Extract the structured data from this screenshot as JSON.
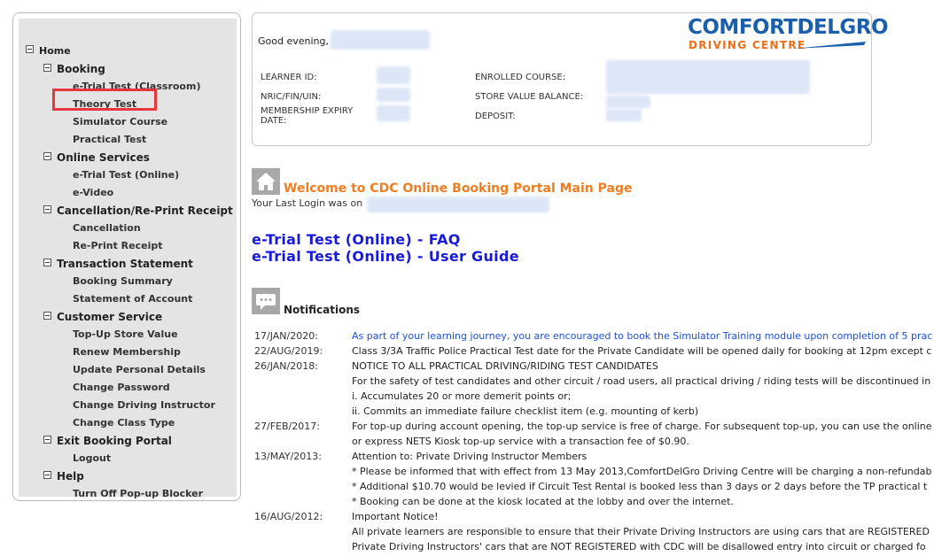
{
  "sidebar": {
    "items": [
      {
        "label": "Home",
        "level": 0,
        "toggle": true
      },
      {
        "label": "Booking",
        "level": 1,
        "toggle": true
      },
      {
        "label": "e-Trial Test (Classroom)",
        "level": 2
      },
      {
        "label": "Theory Test",
        "level": 2,
        "highlighted": true
      },
      {
        "label": "Simulator Course",
        "level": 2
      },
      {
        "label": "Practical Test",
        "level": 2
      },
      {
        "label": "Online Services",
        "level": 1,
        "toggle": true
      },
      {
        "label": "e-Trial Test (Online)",
        "level": 2
      },
      {
        "label": "e-Video",
        "level": 2
      },
      {
        "label": "Cancellation/Re-Print Receipt",
        "level": 1,
        "toggle": true
      },
      {
        "label": "Cancellation",
        "level": 2
      },
      {
        "label": "Re-Print Receipt",
        "level": 2
      },
      {
        "label": "Transaction Statement",
        "level": 1,
        "toggle": true
      },
      {
        "label": "Booking Summary",
        "level": 2
      },
      {
        "label": "Statement of Account",
        "level": 2
      },
      {
        "label": "Customer Service",
        "level": 1,
        "toggle": true
      },
      {
        "label": "Top-Up Store Value",
        "level": 2
      },
      {
        "label": "Renew Membership",
        "level": 2
      },
      {
        "label": "Update Personal Details",
        "level": 2
      },
      {
        "label": "Change Password",
        "level": 2
      },
      {
        "label": "Change Driving Instructor",
        "level": 2
      },
      {
        "label": "Change Class Type",
        "level": 2
      },
      {
        "label": "Exit Booking Portal",
        "level": 1,
        "toggle": true
      },
      {
        "label": "Logout",
        "level": 2
      },
      {
        "label": "Help",
        "level": 1,
        "toggle": true
      },
      {
        "label": "Turn Off Pop-up Blocker",
        "level": 2
      }
    ],
    "highlight_color": "#e8373c"
  },
  "card": {
    "greeting": "Good evening,",
    "labels": {
      "learner_id": "LEARNER ID:",
      "nric": "NRIC/FIN/UIN:",
      "membership_expiry": "MEMBERSHIP EXPIRY DATE:",
      "enrolled_course": "ENROLLED COURSE:",
      "store_value_balance": "STORE VALUE BALANCE:",
      "deposit": "DEPOSIT:"
    },
    "logo": {
      "top": "COMFORTDELGRO",
      "bottom": "DRIVING CENTRE",
      "top_color": "#1b5faa",
      "bottom_color": "#ef6d19"
    }
  },
  "main": {
    "welcome": "Welcome to CDC Online Booking Portal Main Page",
    "last_login": "Your Last Login was on",
    "links": {
      "faq": "e-Trial Test (Online) - FAQ",
      "guide": "e-Trial Test (Online) - User Guide"
    },
    "notifications_title": "Notifications",
    "notifications": [
      {
        "date": "17/JAN/2020:",
        "text": "As part of your learning journey, you are encouraged to book the Simulator Training module upon completion of 5 prac",
        "blue": true
      },
      {
        "date": "22/AUG/2019:",
        "text": "Class 3/3A Traffic Police Practical Test date for the Private Candidate will be opened daily for booking at 12pm except c"
      },
      {
        "date": "26/JAN/2018:",
        "text": "NOTICE TO ALL PRACTICAL DRIVING/RIDING TEST CANDIDATES"
      },
      {
        "date": "",
        "text": "For the safety of test candidates and other circuit / road users, all practical driving / riding tests will be discontinued in"
      },
      {
        "date": "",
        "text": "i. Accumulates 20 or more demerit points or;"
      },
      {
        "date": "",
        "text": "ii. Commits an immediate failure checklist item (e.g. mounting of kerb)"
      },
      {
        "date": "27/FEB/2017:",
        "text": "For top-up during account opening, the top-up service is free of charge. For subsequent top-up, you can use the online"
      },
      {
        "date": "",
        "text": "or express NETS Kiosk top-up service with a transaction fee of $0.90."
      },
      {
        "date": "13/MAY/2013:",
        "text": "Attention to: Private Driving Instructor Members"
      },
      {
        "date": "",
        "text": "* Please be informed that with effect from 13 May 2013,ComfortDelGro Driving Centre will be charging a non-refundab"
      },
      {
        "date": "",
        "text": "* Additional $10.70 would be levied if Circuit Test Rental is booked less than 3 days or 2 days before the TP practical t"
      },
      {
        "date": "",
        "text": "* Booking can be done at the kiosk located at the lobby and over the internet."
      },
      {
        "date": "16/AUG/2012:",
        "text": "Important Notice!"
      },
      {
        "date": "",
        "text": "All private learners are responsible to ensure that their Private Driving Instructors are using cars that are REGISTERED"
      },
      {
        "date": "",
        "text": "Private Driving Instructors' cars that are NOT REGISTERED with CDC will be disallowed entry into circuit or charged fo"
      }
    ]
  },
  "colors": {
    "link": "#1a1adb",
    "welcome": "#ef7d22",
    "notice_blue": "#1f4fd8"
  },
  "icons": [
    "home-icon",
    "chat-icon",
    "toggle-minus-icon"
  ]
}
